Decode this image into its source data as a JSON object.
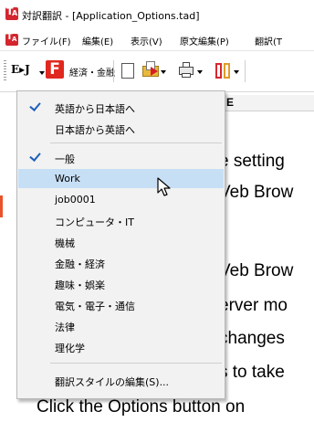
{
  "window": {
    "title": "対訳翻訳 - [Application_Options.tad]",
    "logo_icon": "app-logo-icon"
  },
  "menubar": {
    "items": [
      "ファイル(F)",
      "編集(E)",
      "表示(V)",
      "原文編集(P)",
      "翻訳(T"
    ]
  },
  "toolbar": {
    "direction_label": "E▸J",
    "field_icon_letter": "F",
    "field_label": "経済・金融",
    "icons": [
      "new-document-icon",
      "open-file-icon",
      "print-icon",
      "split-view-icon"
    ]
  },
  "document": {
    "column_header": "E",
    "lines": [
      "e setting",
      "Veb Brow",
      "Veb Brow",
      "erver mo",
      "changes",
      "s to take",
      "Click the Options button on"
    ]
  },
  "dropdown": {
    "direction_items": [
      {
        "label": "英語から日本語へ",
        "checked": true
      },
      {
        "label": "日本語から英語へ",
        "checked": false
      }
    ],
    "field_items": [
      {
        "label": "一般",
        "checked": true,
        "selected": false
      },
      {
        "label": "Work",
        "checked": false,
        "selected": true
      },
      {
        "label": "job0001",
        "checked": false,
        "selected": false
      },
      {
        "label": "コンピュータ・IT",
        "checked": false,
        "selected": false
      },
      {
        "label": "機械",
        "checked": false,
        "selected": false
      },
      {
        "label": "金融・経済",
        "checked": false,
        "selected": false
      },
      {
        "label": "趣味・娯楽",
        "checked": false,
        "selected": false
      },
      {
        "label": "電気・電子・通信",
        "checked": false,
        "selected": false
      },
      {
        "label": "法律",
        "checked": false,
        "selected": false
      },
      {
        "label": "理化学",
        "checked": false,
        "selected": false
      }
    ],
    "footer_item": "翻訳スタイルの編集(S)..."
  },
  "colors": {
    "selection": "#c7dff5",
    "check": "#1f5fb8",
    "brand_red": "#d4262e"
  }
}
